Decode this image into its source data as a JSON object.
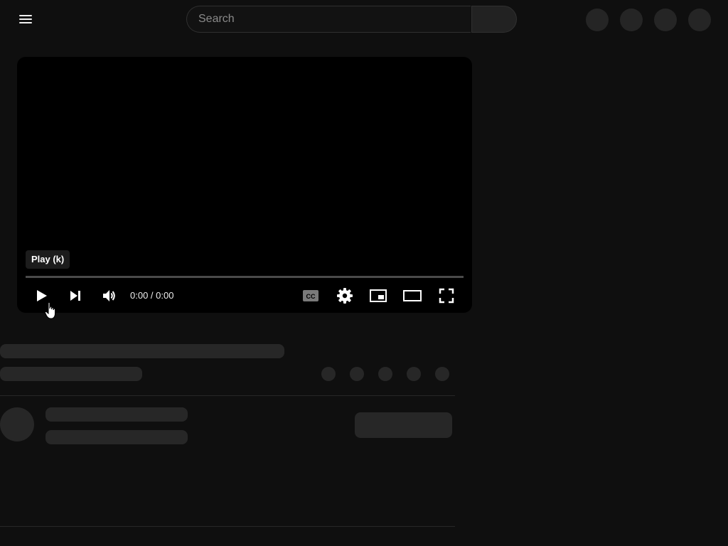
{
  "search": {
    "placeholder": "Search"
  },
  "player": {
    "tooltip": "Play (k)",
    "time_current": "0:00",
    "time_total": "0:00",
    "time_separator": " / ",
    "progress": 0
  },
  "icons": {
    "menu": "menu-icon",
    "search": "search-icon",
    "play": "play-icon",
    "next": "skip-next-icon",
    "volume": "volume-icon",
    "captions": "captions-icon",
    "settings": "gear-icon",
    "miniplayer": "miniplayer-icon",
    "theater": "theater-mode-icon",
    "fullscreen": "fullscreen-icon"
  },
  "colors": {
    "background": "#0f0f0f",
    "player_bg": "#000000",
    "skeleton": "#272727",
    "text": "#f1f1f1"
  }
}
